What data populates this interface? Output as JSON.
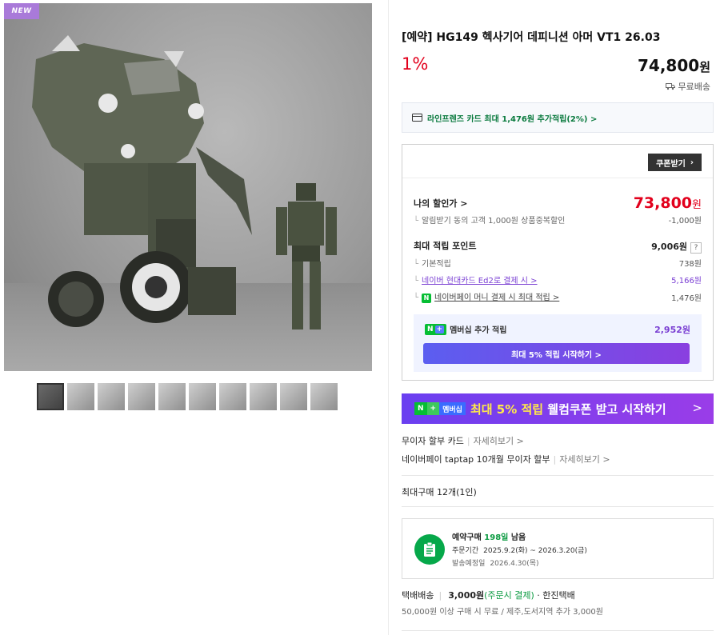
{
  "gallery": {
    "badge": "NEW",
    "thumb_count": 10
  },
  "product": {
    "title": "[예약] HG149 헥사기어 데피니션 아머 VT1 26.03",
    "discount": "1%",
    "price": "74,800",
    "price_unit": "원",
    "shipping": "무료배송"
  },
  "card_benefit": "라인프렌즈 카드 최대 1,476원 추가적립(2%) >",
  "benefit": {
    "coupon_button": "쿠폰받기",
    "my_price_label": "나의 할인가 >",
    "my_price": "73,800",
    "my_price_unit": "원",
    "alarm_label": "알림받기 동의 고객 1,000원 상품중복할인",
    "alarm_value": "-1,000원",
    "points_label": "최대 적립 포인트",
    "points_value": "9,006원",
    "points_help": "?",
    "basic_label": "기본적립",
    "basic_value": "738원",
    "card_label": "네이버 현대카드 Ed2로 결제 시 >",
    "card_value": "5,166원",
    "npay_label": "네이버페이 머니 결제 시 최대 적립 >",
    "npay_value": "1,476원",
    "membership_label": "멤버십 추가 적립",
    "membership_value": "2,952원",
    "membership_button": "최대 5% 적립 시작하기 >"
  },
  "banner": {
    "tag_n": "N",
    "tag_plus": "+",
    "tag_member": "멤버십",
    "highlight": "최대 5% 적립",
    "text": " 웰컴쿠폰 받고 시작하기",
    "chevron": ">"
  },
  "installment": {
    "row1_label": "무이자 할부 카드",
    "row1_more": "자세히보기 >",
    "row2_label": "네이버페이 taptap 10개월 무이자 할부",
    "row2_more": "자세히보기 >"
  },
  "max_purchase": "최대구매 12개(1인)",
  "preorder": {
    "title": "예약구매",
    "days": "198일",
    "suffix": " 남음",
    "period_label": "주문기간",
    "period_value": "2025.9.2(화) ~ 2026.3.20(금)",
    "ship_label": "발송예정일",
    "ship_value": "2026.4.30(목)"
  },
  "delivery": {
    "method": "택배배송",
    "fee": "3,000원",
    "pay_note": "(주문시 결제)",
    "carrier": " · 한진택배",
    "note": "50,000원 이상 구매 시 무료 / 제주,도서지역 추가 3,000원"
  },
  "colors": {
    "sale_red": "#e2001c",
    "npay_green": "#06be34",
    "purple": "#7a3fd3"
  }
}
